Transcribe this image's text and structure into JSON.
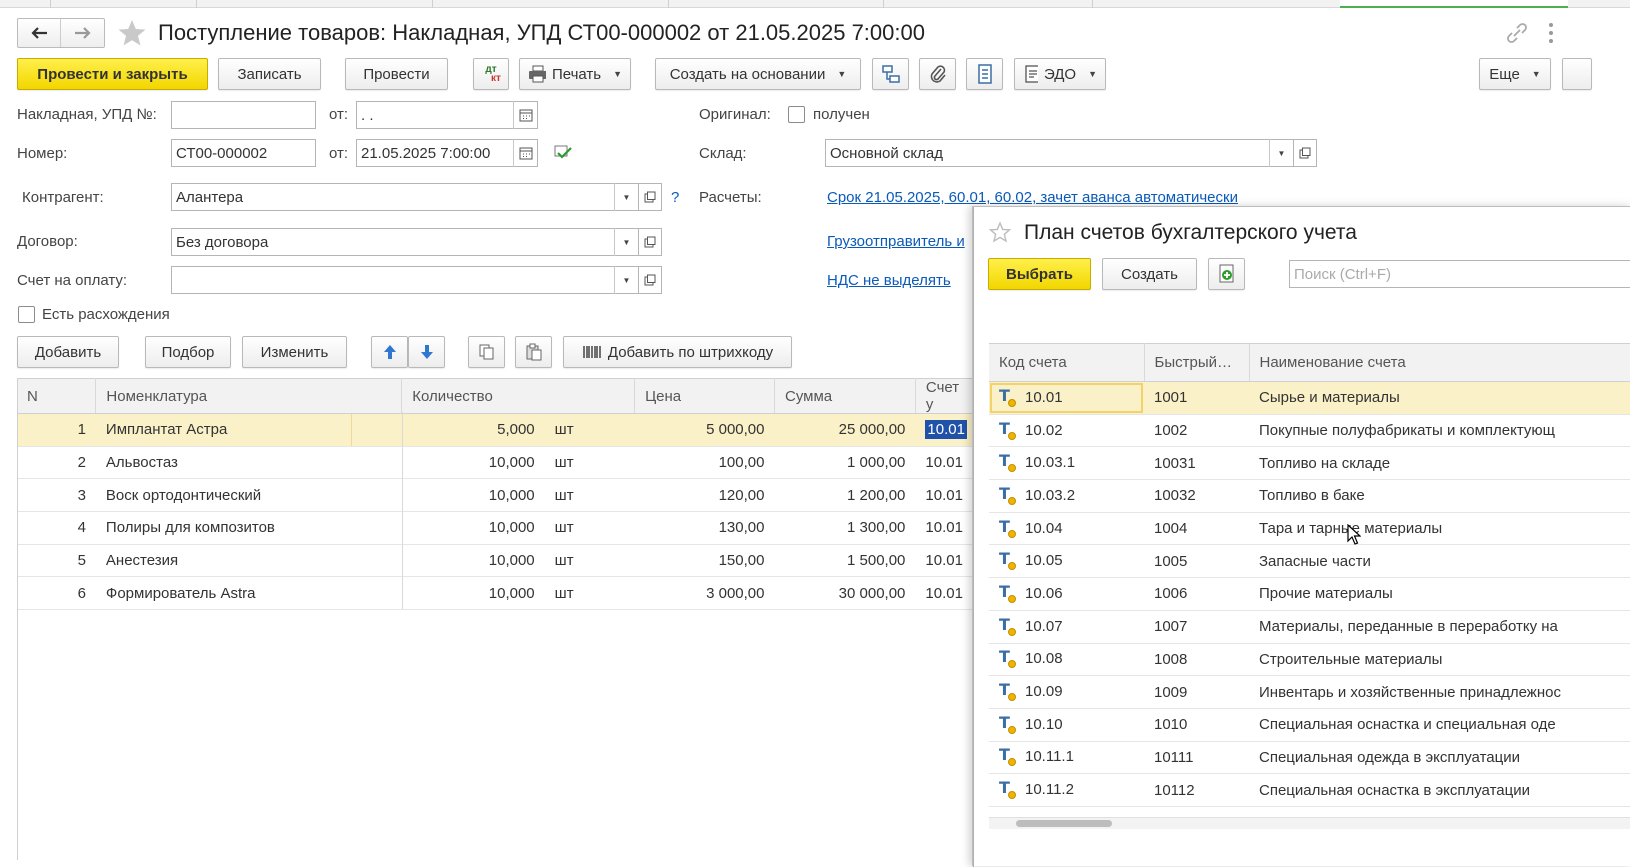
{
  "window": {
    "title": "Поступление товаров: Накладная, УПД СТ00-000002 от 21.05.2025 7:00:00"
  },
  "toolbar": {
    "post_close": "Провести и закрыть",
    "save": "Записать",
    "post": "Провести",
    "dtkt_top": "дт",
    "dtkt_bottom": "кт",
    "print": "Печать",
    "create_basis": "Создать на основании",
    "edo": "ЭДО",
    "more": "Еще"
  },
  "form": {
    "invoice_label": "Накладная, УПД №:",
    "invoice_value": "",
    "from_label": "от:",
    "invoice_date": " .  .",
    "original_label": "Оригинал:",
    "original_checkbox": "получен",
    "number_label": "Номер:",
    "number_value": "СТ00-000002",
    "from_label2": "от:",
    "number_date": "21.05.2025  7:00:00",
    "warehouse_label": "Склад:",
    "warehouse_value": "Основной склад",
    "counterparty_label": "Контрагент:",
    "counterparty_value": "Алантера",
    "help": "?",
    "settlements_label": "Расчеты:",
    "settlements_link": "Срок 21.05.2025, 60.01, 60.02, зачет аванса автоматически",
    "contract_label": "Договор:",
    "contract_value": "Без договора",
    "shipper_link": "Грузоотправитель и",
    "payment_label": "Счет на оплату:",
    "payment_value": "",
    "vat_link": "НДС не выделять",
    "discrepancy": "Есть расхождения"
  },
  "table_toolbar": {
    "add": "Добавить",
    "pick": "Подбор",
    "change": "Изменить",
    "barcode": "Добавить по штрихкоду"
  },
  "goods_table": {
    "headers": [
      "N",
      "Номенклатура",
      "Количество",
      "Цена",
      "Сумма",
      "Счет у"
    ],
    "rows": [
      {
        "n": "1",
        "name": "Имплантат Астра",
        "qty": "5,000",
        "unit": "шт",
        "price": "5 000,00",
        "sum": "25 000,00",
        "acct": "10.01"
      },
      {
        "n": "2",
        "name": "Альвостаз",
        "qty": "10,000",
        "unit": "шт",
        "price": "100,00",
        "sum": "1 000,00",
        "acct": "10.01"
      },
      {
        "n": "3",
        "name": "Воск ортодонтический",
        "qty": "10,000",
        "unit": "шт",
        "price": "120,00",
        "sum": "1 200,00",
        "acct": "10.01"
      },
      {
        "n": "4",
        "name": "Полиры для композитов",
        "qty": "10,000",
        "unit": "шт",
        "price": "130,00",
        "sum": "1 300,00",
        "acct": "10.01"
      },
      {
        "n": "5",
        "name": "Анестезия",
        "qty": "10,000",
        "unit": "шт",
        "price": "150,00",
        "sum": "1 500,00",
        "acct": "10.01"
      },
      {
        "n": "6",
        "name": "Формирователь Astra",
        "qty": "10,000",
        "unit": "шт",
        "price": "3 000,00",
        "sum": "30 000,00",
        "acct": "10.01"
      }
    ]
  },
  "popup": {
    "title": "План счетов бухгалтерского учета",
    "select": "Выбрать",
    "create": "Создать",
    "search_placeholder": "Поиск (Ctrl+F)",
    "headers": [
      "Код счета",
      "Быстрый…",
      "Наименование счета"
    ],
    "rows": [
      {
        "code": "10.01",
        "quick": "1001",
        "name": "Сырье и материалы"
      },
      {
        "code": "10.02",
        "quick": "1002",
        "name": "Покупные полуфабрикаты и комплектующ"
      },
      {
        "code": "10.03.1",
        "quick": "10031",
        "name": "Топливо на складе"
      },
      {
        "code": "10.03.2",
        "quick": "10032",
        "name": "Топливо в баке"
      },
      {
        "code": "10.04",
        "quick": "1004",
        "name": "Тара и тарные материалы"
      },
      {
        "code": "10.05",
        "quick": "1005",
        "name": "Запасные части"
      },
      {
        "code": "10.06",
        "quick": "1006",
        "name": "Прочие материалы"
      },
      {
        "code": "10.07",
        "quick": "1007",
        "name": "Материалы, переданные в переработку на"
      },
      {
        "code": "10.08",
        "quick": "1008",
        "name": "Строительные материалы"
      },
      {
        "code": "10.09",
        "quick": "1009",
        "name": "Инвентарь и хозяйственные принадлежнос"
      },
      {
        "code": "10.10",
        "quick": "1010",
        "name": "Специальная оснастка и специальная оде"
      },
      {
        "code": "10.11.1",
        "quick": "10111",
        "name": "Специальная одежда в эксплуатации"
      },
      {
        "code": "10.11.2",
        "quick": "10112",
        "name": "Специальная оснастка в эксплуатации"
      }
    ]
  },
  "colors": {
    "primary_button": "#f2d600",
    "link": "#0a5ab9",
    "selected_row": "#fbf1c8"
  }
}
